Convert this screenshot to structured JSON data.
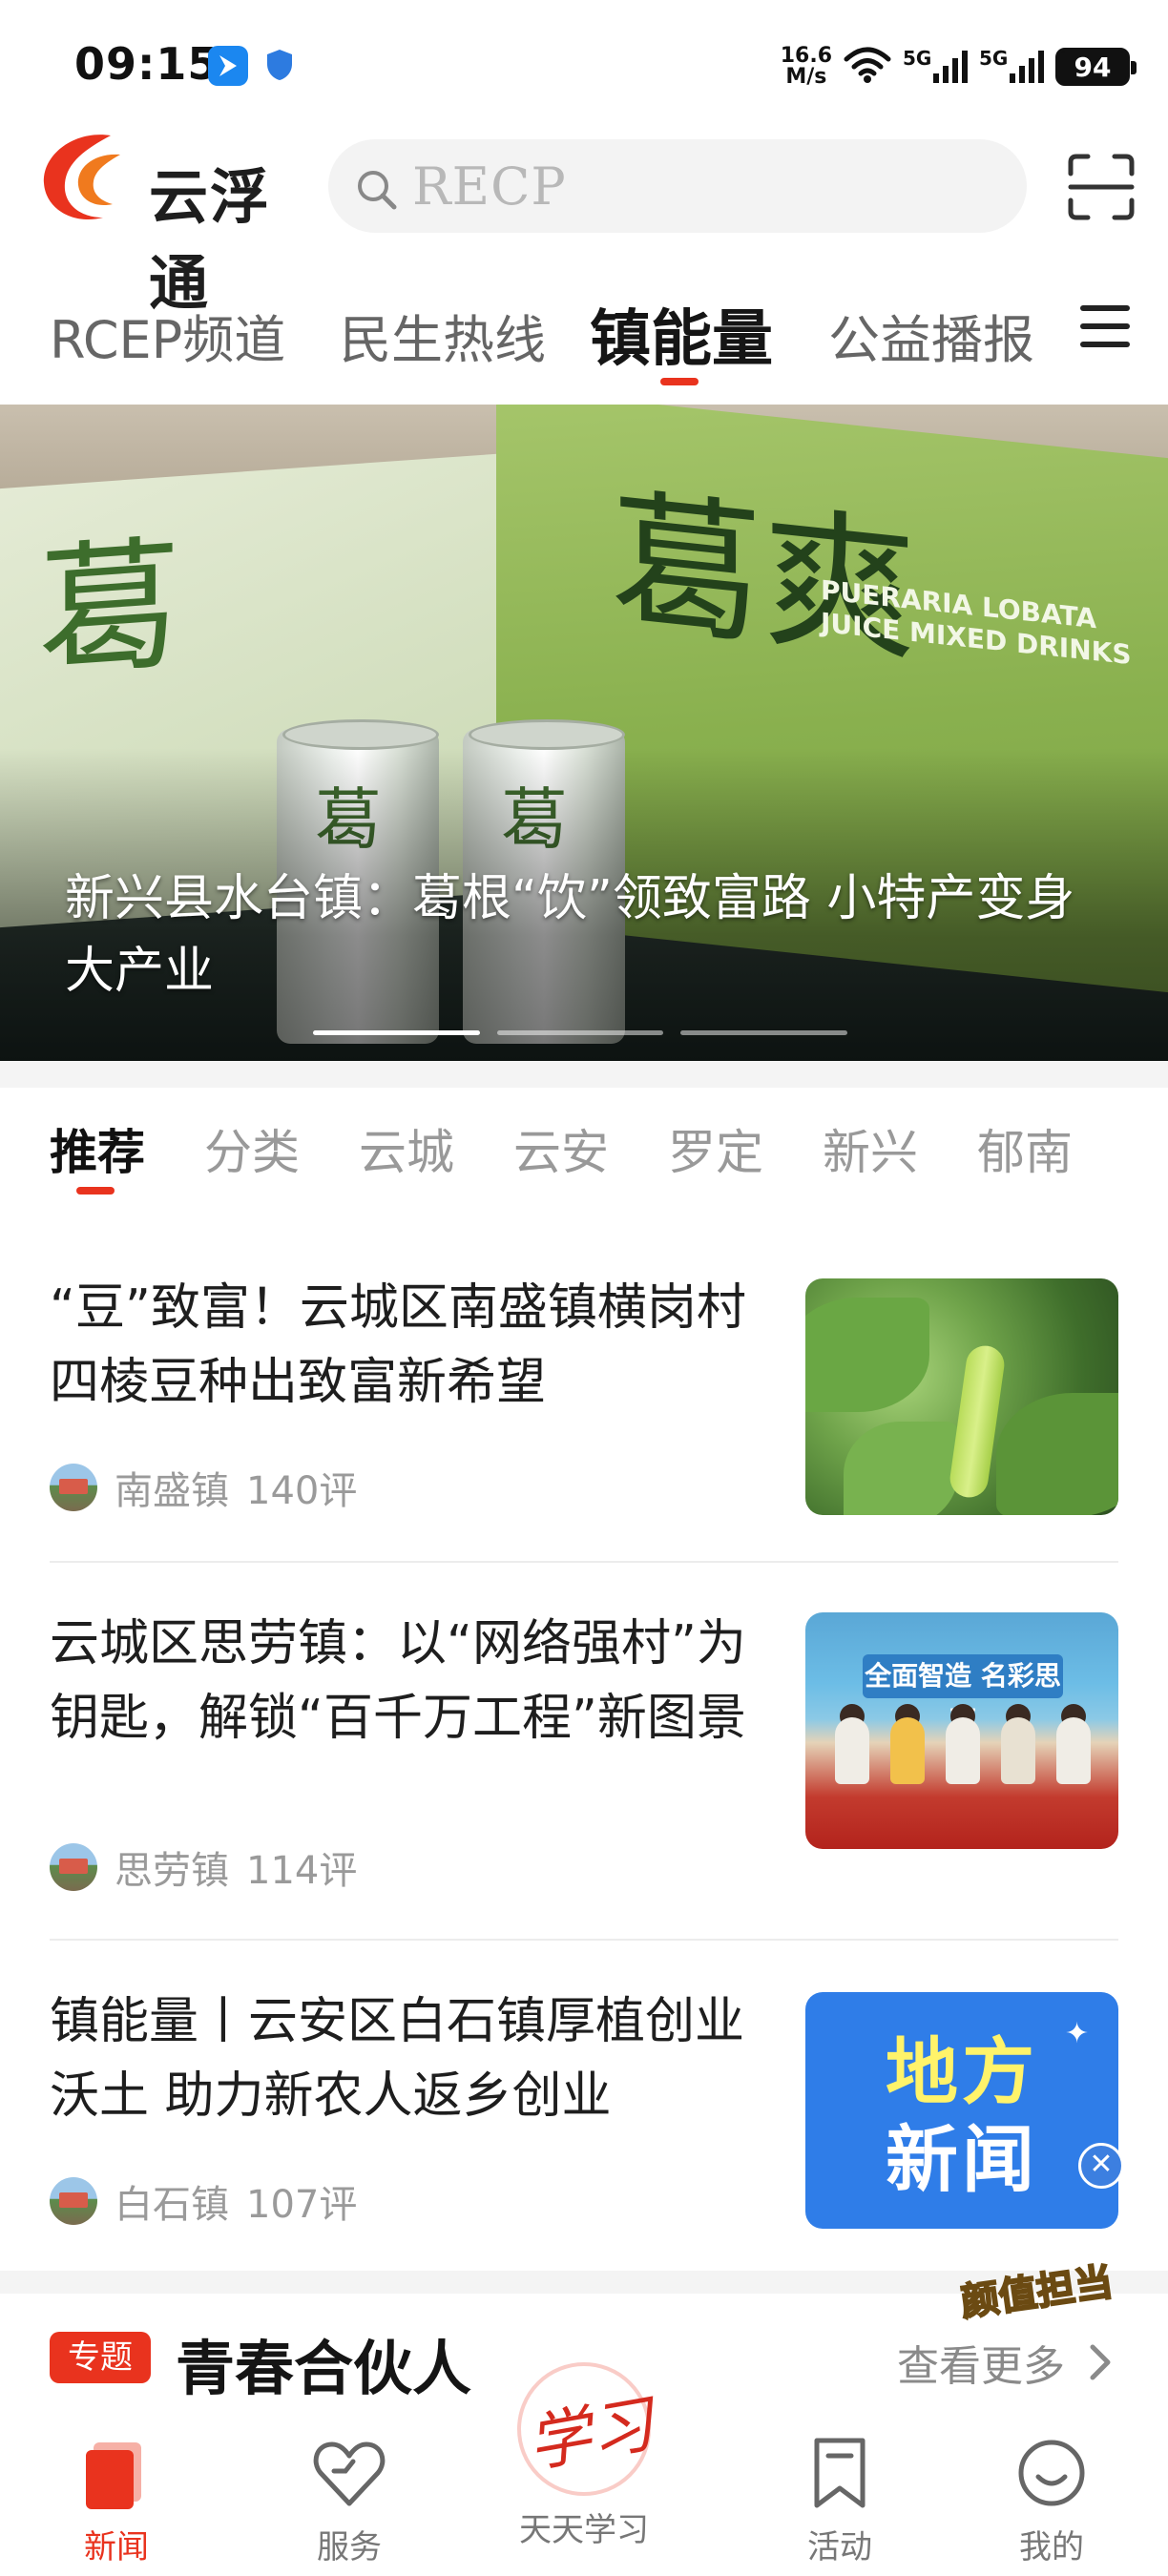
{
  "status_bar": {
    "time": "09:15",
    "speed": "16.6",
    "speed_unit": "M/s",
    "net1": "5G",
    "net2": "5G",
    "battery": "94"
  },
  "header": {
    "app_name": "云浮通",
    "search_placeholder": "RECP",
    "icons": {
      "search": "search-icon",
      "scan": "scan-icon"
    }
  },
  "channel_tabs": [
    {
      "label": "RCEP频道",
      "active": false
    },
    {
      "label": "民生热线",
      "active": false
    },
    {
      "label": "镇能量",
      "active": true
    },
    {
      "label": "公益播报",
      "active": false
    }
  ],
  "banner": {
    "title": "新兴县水台镇：葛根“饮”领致富路 小特产变身大产业",
    "image_text": {
      "box_left": "葛",
      "box_right": "葛爽",
      "box_right_en": "PUERARIA LOBATA JUICE MIXED DRINKS",
      "can": "葛"
    },
    "slides": 3,
    "active_slide": 0
  },
  "region_tabs": [
    {
      "label": "推荐",
      "active": true
    },
    {
      "label": "分类",
      "active": false
    },
    {
      "label": "云城",
      "active": false
    },
    {
      "label": "云安",
      "active": false
    },
    {
      "label": "罗定",
      "active": false
    },
    {
      "label": "新兴",
      "active": false
    },
    {
      "label": "郁南",
      "active": false
    }
  ],
  "news": [
    {
      "title": "“豆”致富！云城区南盛镇横岗村四棱豆种出致富新希望",
      "source": "南盛镇",
      "comments": "140评"
    },
    {
      "title": "云城区思劳镇：以“网络强村”为钥匙，解锁“百千万工程”新图景",
      "source": "思劳镇",
      "comments": "114评"
    },
    {
      "title": "镇能量丨云安区白石镇厚植创业沃土 助力新农人返乡创业",
      "source": "白石镇",
      "comments": "107评"
    }
  ],
  "thumbs": {
    "thumb2_banner": "全面智造 名彩思劳",
    "thumb3_line1": "地方",
    "thumb3_line2": "新闻"
  },
  "floating_badge": "颜值担当",
  "topic": {
    "badge": "专题",
    "title": "青春合伙人",
    "more": "查看更多"
  },
  "bottom_nav": [
    {
      "label": "新闻",
      "icon": "news-icon",
      "active": true
    },
    {
      "label": "服务",
      "icon": "heart-icon",
      "active": false
    },
    {
      "label": "天天学习",
      "icon": "study-seal-icon",
      "active": false,
      "seal_text": "学习"
    },
    {
      "label": "活动",
      "icon": "bookmark-icon",
      "active": false
    },
    {
      "label": "我的",
      "icon": "smile-icon",
      "active": false
    }
  ],
  "colors": {
    "accent": "#e9331e",
    "search_bg": "#f3f3f3",
    "muted_text": "#9a9a9a",
    "nav_blue": "#2f7de8"
  }
}
